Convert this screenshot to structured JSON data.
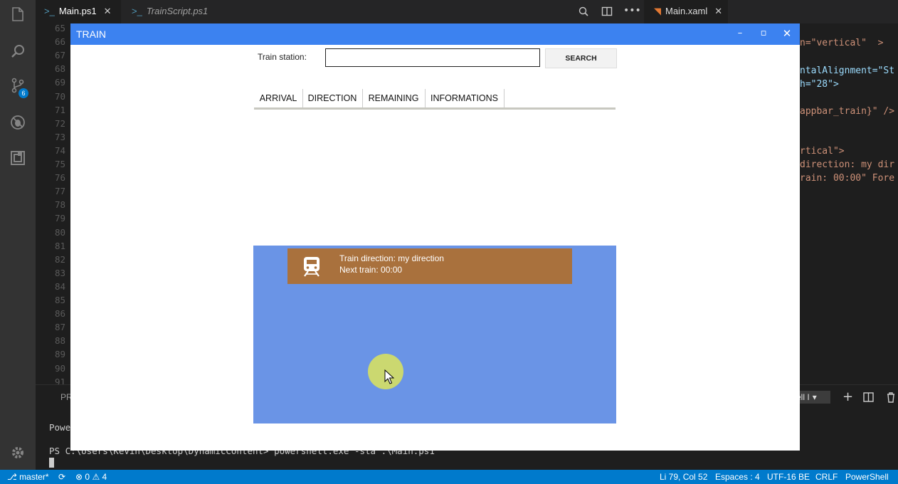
{
  "vscode": {
    "tabs": [
      {
        "label": "Main.ps1",
        "active": true
      },
      {
        "label": "TrainScript.ps1",
        "active": false
      },
      {
        "label": "Main.xaml",
        "active": true
      }
    ],
    "line_numbers": [
      "65",
      "66",
      "67",
      "68",
      "69",
      "70",
      "71",
      "72",
      "73",
      "74",
      "75",
      "76",
      "77",
      "78",
      "79",
      "80",
      "81",
      "82",
      "83",
      "84",
      "85",
      "86",
      "87",
      "88",
      "89",
      "90",
      "91"
    ],
    "code_fragments": [
      {
        "text": "n=\"vertical\"  >",
        "color": "#ce9178"
      },
      {
        "text": "ntalAlignment=\"St",
        "color": "#9cdcfe"
      },
      {
        "text": "h=\"28\">",
        "color": "#9cdcfe"
      },
      {
        "text": "appbar_train}\" />",
        "color": "#ce9178"
      },
      {
        "text": "rtical\">",
        "color": "#ce9178"
      },
      {
        "text": "direction: my dir",
        "color": "#ce9178"
      },
      {
        "text": "rain: 00:00\" Fore",
        "color": "#ce9178"
      }
    ],
    "activity_badge": "6",
    "panel_tab_fragment": "PR",
    "terminal_selector": "ell I",
    "terminal_lines": [
      "Powe",
      "PS C:\\Users\\Kevin\\Desktop\\DynamicContent> powershell.exe -sta .\\Main.ps1"
    ],
    "status": {
      "branch": "master*",
      "errors": "0",
      "warnings": "4",
      "position": "Li 79, Col 52",
      "spaces": "Espaces : 4",
      "encoding": "UTF-16 BE",
      "eol": "CRLF",
      "language": "PowerShell"
    },
    "accent": "#007acc"
  },
  "app": {
    "title": "TRAIN",
    "title_color": "#3c82f0",
    "station_label": "Train station:",
    "station_value": "",
    "search_label": "SEARCH",
    "columns": [
      "ARRIVAL",
      "DIRECTION",
      "REMAINING",
      "INFORMATIONS"
    ],
    "tile_color": "#6a94e6",
    "card": {
      "direction": "Train direction: my direction",
      "next": "Next train: 00:00",
      "icon": "train-icon",
      "color": "#a9713d"
    }
  }
}
